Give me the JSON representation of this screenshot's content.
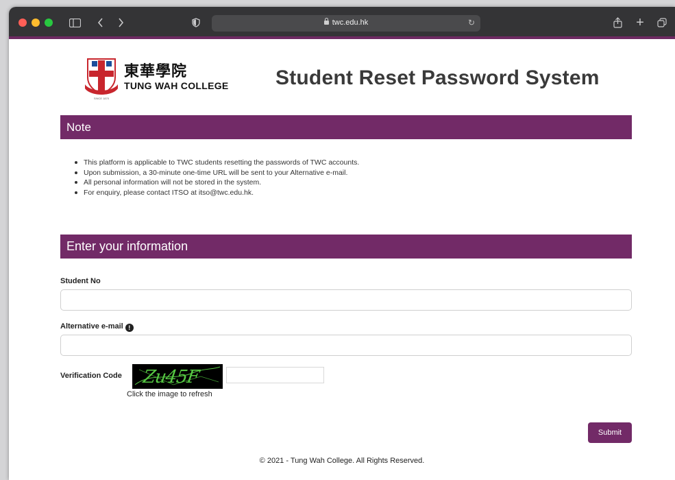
{
  "browser": {
    "url": "twc.edu.hk"
  },
  "header": {
    "logo_cn": "東華學院",
    "logo_en": "TUNG WAH COLLEGE",
    "title": "Student Reset Password System"
  },
  "note": {
    "heading": "Note",
    "items": [
      "This platform is applicable to TWC students resetting the passwords of TWC accounts.",
      "Upon submission, a 30-minute one-time URL will be sent to your Alternative e-mail.",
      "All personal information will not be stored in the system.",
      "For enquiry, please contact ITSO at itso@twc.edu.hk."
    ]
  },
  "form": {
    "heading": "Enter your information",
    "student_no_label": "Student No",
    "student_no_value": "",
    "email_label": "Alternative e-mail",
    "email_value": "",
    "verification_label": "Verification Code",
    "captcha_text": "Zu45F",
    "captcha_hint": "Click the image to refresh",
    "verification_value": "",
    "submit_label": "Submit"
  },
  "footer": {
    "text": "© 2021 - Tung Wah College. All Rights Reserved."
  },
  "colors": {
    "brand_purple": "#722a67",
    "toolbar": "#343436"
  }
}
